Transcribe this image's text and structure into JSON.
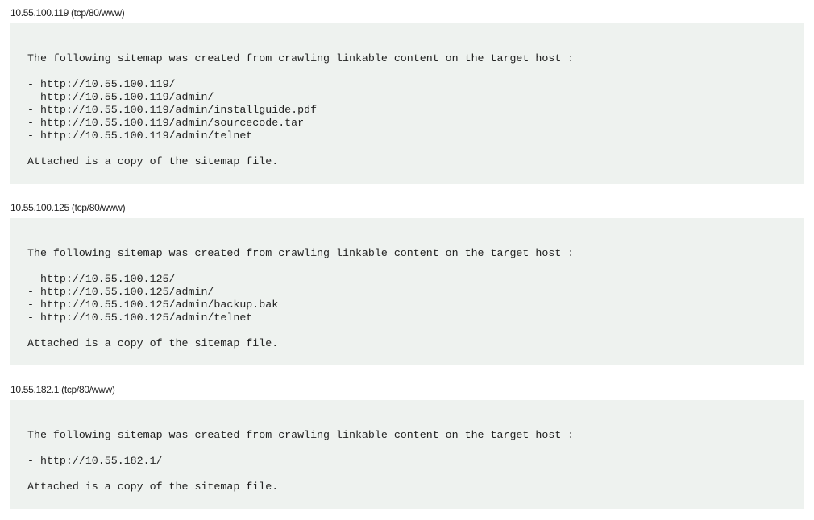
{
  "sections": [
    {
      "header": "10.55.100.119 (tcp/80/www)",
      "intro": "The following sitemap was created from crawling linkable content on the target host :",
      "urls": [
        "- http://10.55.100.119/",
        "- http://10.55.100.119/admin/",
        "- http://10.55.100.119/admin/installguide.pdf",
        "- http://10.55.100.119/admin/sourcecode.tar",
        "- http://10.55.100.119/admin/telnet"
      ],
      "footer": "Attached is a copy of the sitemap file."
    },
    {
      "header": "10.55.100.125 (tcp/80/www)",
      "intro": "The following sitemap was created from crawling linkable content on the target host :",
      "urls": [
        "- http://10.55.100.125/",
        "- http://10.55.100.125/admin/",
        "- http://10.55.100.125/admin/backup.bak",
        "- http://10.55.100.125/admin/telnet"
      ],
      "footer": "Attached is a copy of the sitemap file."
    },
    {
      "header": "10.55.182.1 (tcp/80/www)",
      "intro": "The following sitemap was created from crawling linkable content on the target host :",
      "urls": [
        "- http://10.55.182.1/"
      ],
      "footer": "Attached is a copy of the sitemap file."
    }
  ]
}
